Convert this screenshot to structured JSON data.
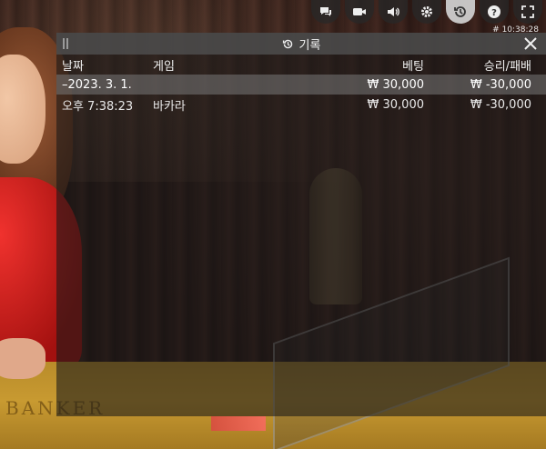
{
  "toolbar": {
    "buttons": [
      {
        "icon": "chat-icon"
      },
      {
        "icon": "video-icon"
      },
      {
        "icon": "volume-icon"
      },
      {
        "icon": "settings-icon"
      },
      {
        "icon": "history-icon",
        "active": true
      },
      {
        "icon": "help-icon"
      },
      {
        "icon": "fullscreen-icon"
      }
    ],
    "clock": "# 10:38:28"
  },
  "history": {
    "title": "기록",
    "columns": {
      "date": "날짜",
      "game": "게임",
      "bet": "베팅",
      "result": "승리/패배"
    },
    "group": {
      "date": "–2023. 3. 1.",
      "bet": "₩ 30,000",
      "result": "₩ -30,000"
    },
    "entries": [
      {
        "time": "오후 7:38:23",
        "game": "바카라",
        "bet": "₩ 30,000",
        "result": "₩ -30,000"
      }
    ]
  },
  "scene": {
    "table_text": "BANKER"
  },
  "colors": {
    "panel_header": "#505050",
    "date_row": "#787878",
    "table_felt": "#c89a31"
  }
}
